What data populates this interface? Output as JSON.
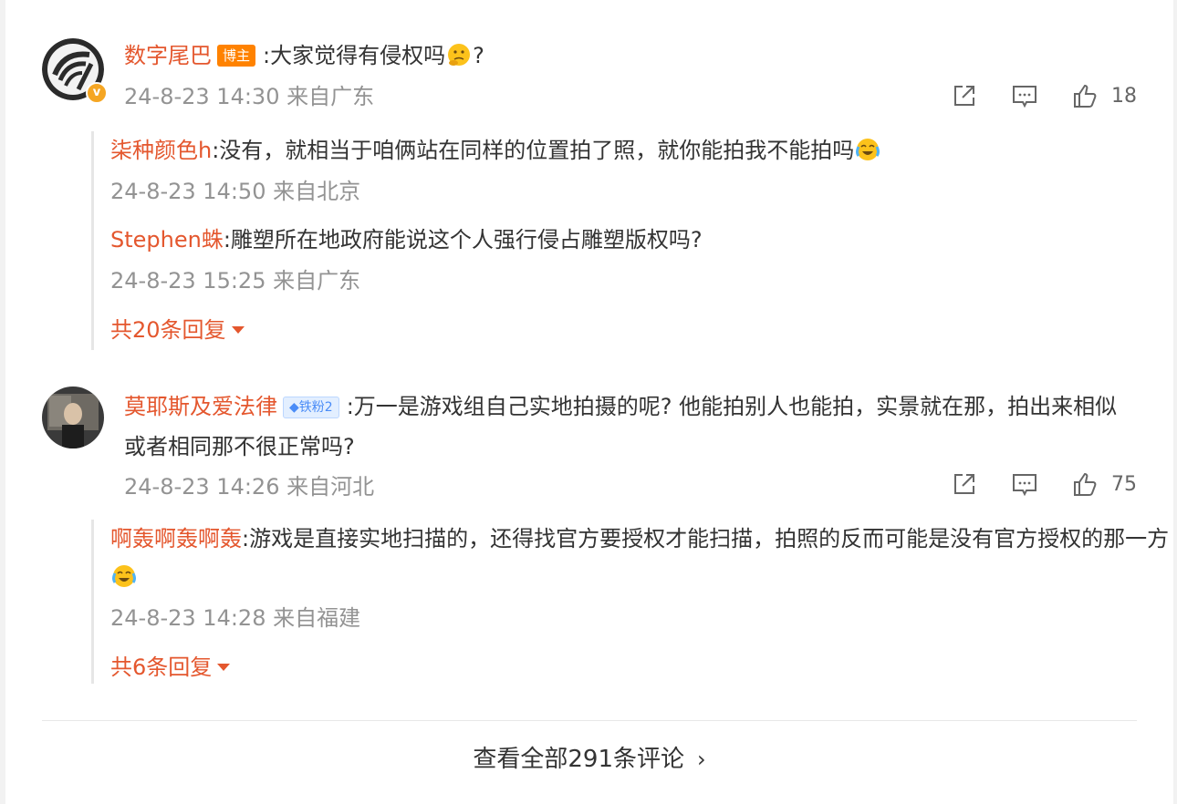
{
  "comments": [
    {
      "username": "数字尾巴",
      "badge": "博主",
      "text": ":大家觉得有侵权吗",
      "text_suffix": "?",
      "emoji": "thinking-emoji",
      "meta": "24-8-23 14:30 来自广东",
      "likes": "18",
      "replies": [
        {
          "username": "柒种颜色h",
          "text": ":没有，就相当于咱俩站在同样的位置拍了照，就你能拍我不能拍吗",
          "emoji": "crying-laugh-emoji",
          "meta": "24-8-23 14:50 来自北京"
        },
        {
          "username": "Stephen蛛",
          "text": ":雕塑所在地政府能说这个人强行侵占雕塑版权吗?",
          "meta": "24-8-23 15:25 来自广东"
        }
      ],
      "more_replies": "共20条回复"
    },
    {
      "username": "莫耶斯及爱法律",
      "badge": "铁粉2",
      "text": ":万一是游戏组自己实地拍摄的呢? 他能拍别人也能拍，实景就在那，拍出来相似或者相同那不很正常吗?",
      "meta": "24-8-23 14:26 来自河北",
      "likes": "75",
      "replies": [
        {
          "username": "啊轰啊轰啊轰",
          "text": ":游戏是直接实地扫描的，还得找官方要授权才能扫描，拍照的反而可能是没有官方授权的那一方",
          "emoji": "crying-laugh-emoji",
          "meta": "24-8-23 14:28 来自福建"
        }
      ],
      "more_replies": "共6条回复"
    }
  ],
  "view_all": "查看全部291条评论",
  "colors": {
    "accent": "#e4572e",
    "meta": "#939393",
    "author_badge": "#ff8200",
    "fan_badge": "#4a8cf7"
  }
}
